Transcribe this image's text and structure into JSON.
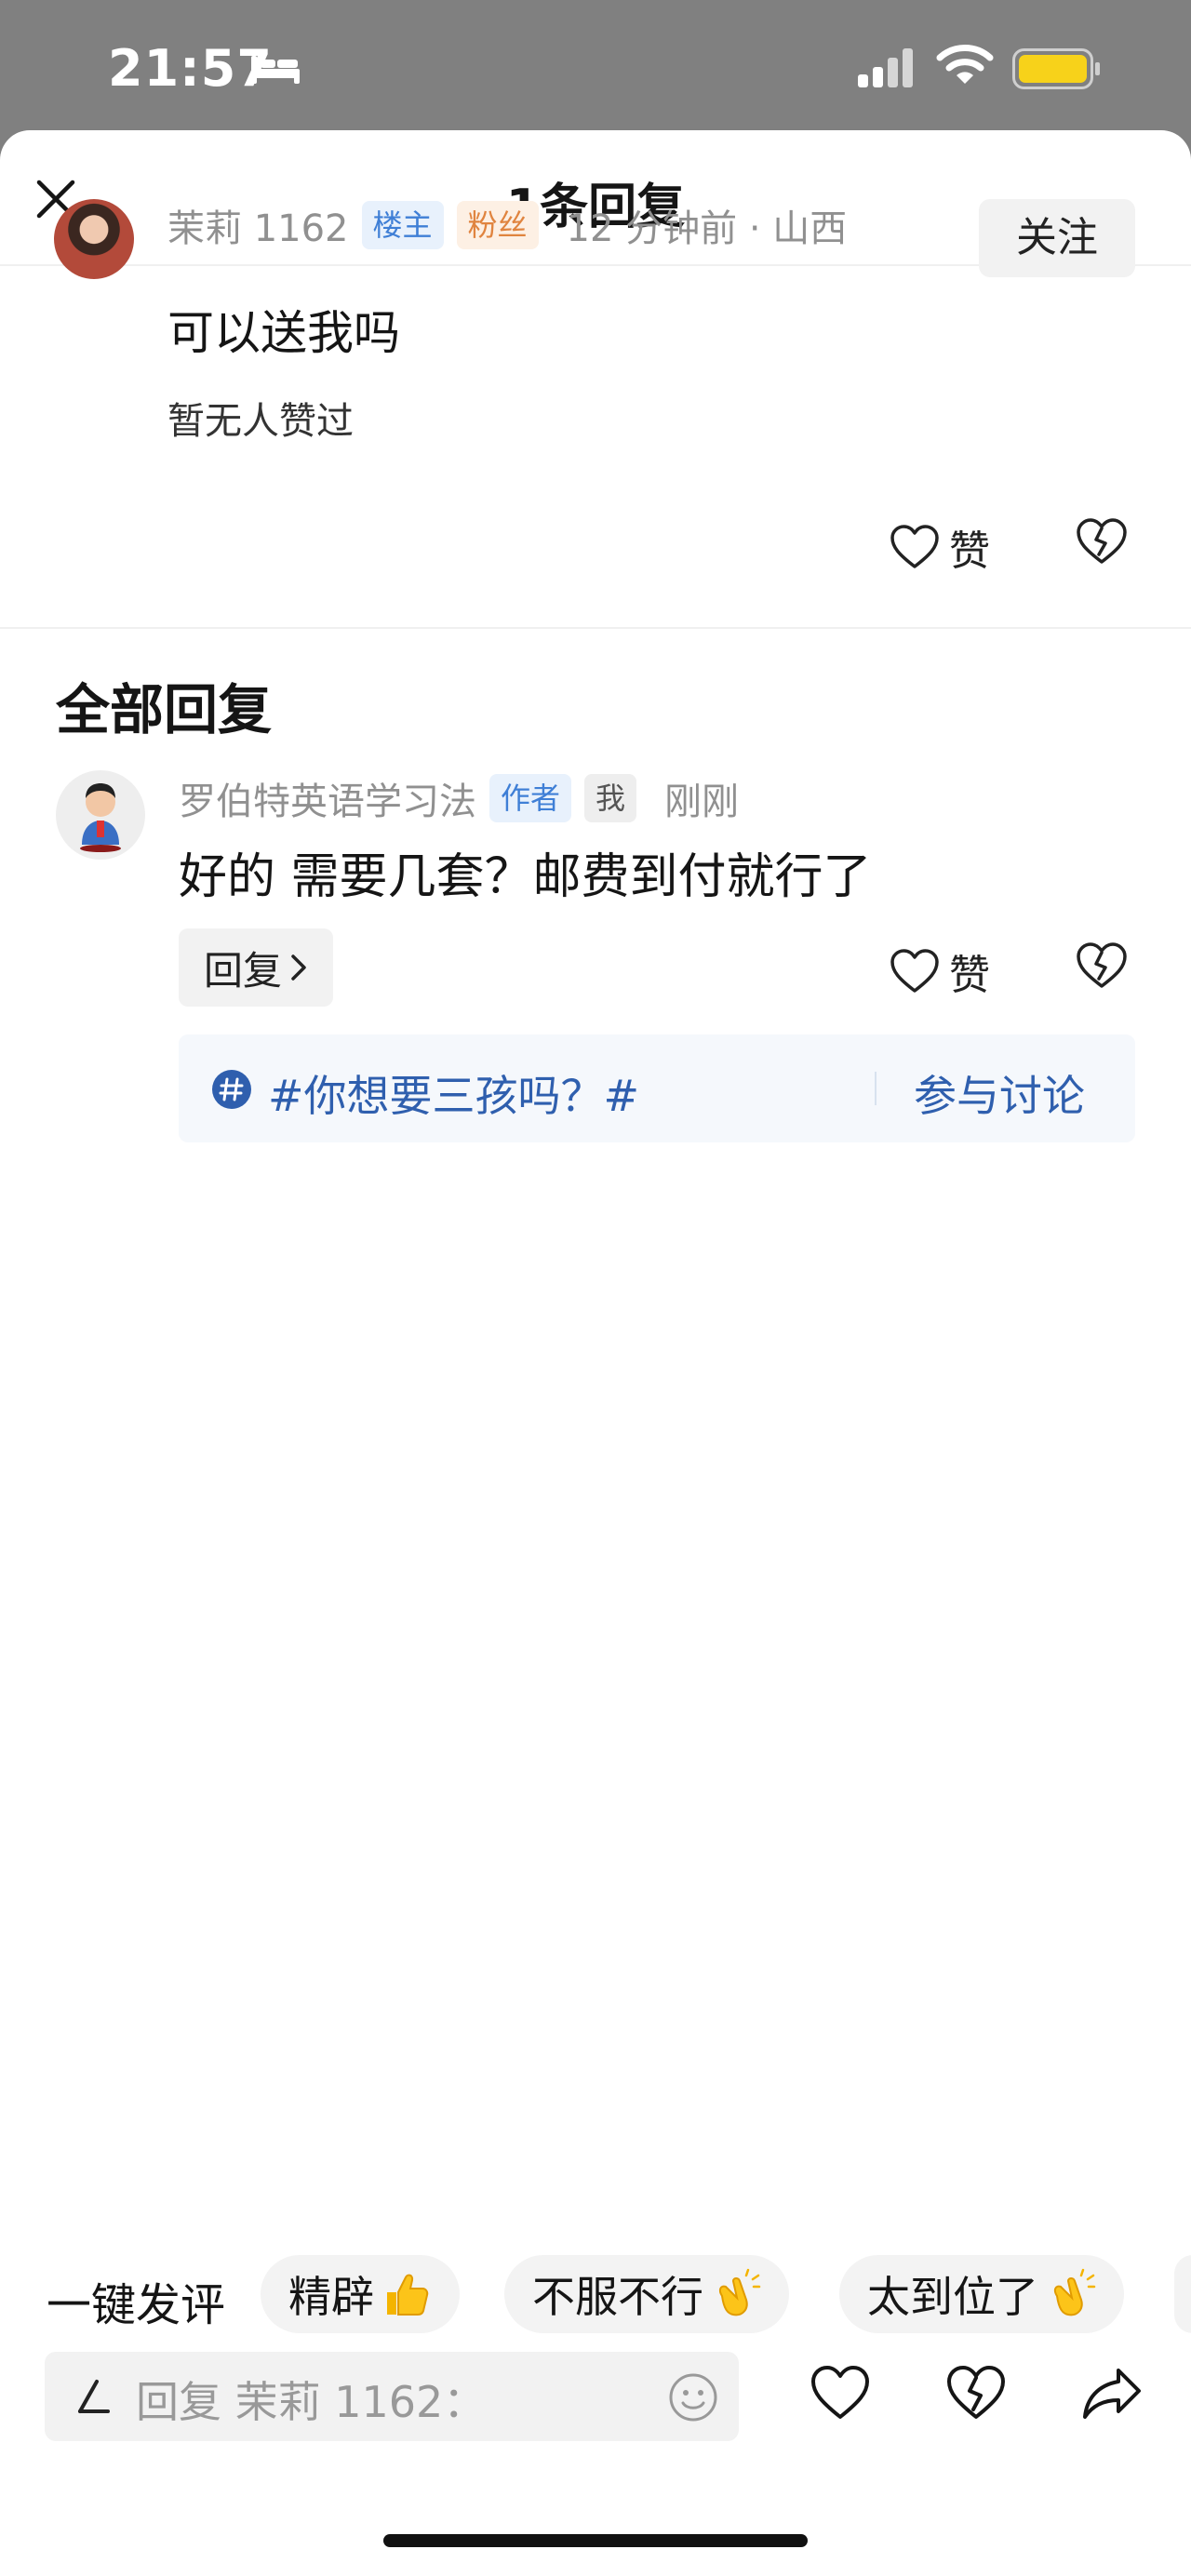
{
  "status_bar": {
    "time": "21:57"
  },
  "header": {
    "title": "1条回复"
  },
  "original_comment": {
    "username": "茉莉 1162",
    "tags": [
      "楼主",
      "粉丝"
    ],
    "time_location": "12 分钟前 · 山西",
    "follow_label": "关注",
    "text": "可以送我吗",
    "likes_status": "暂无人赞过",
    "like_label": "赞"
  },
  "replies_section": {
    "title": "全部回复"
  },
  "reply": {
    "username": "罗伯特英语学习法",
    "tags": [
      "作者",
      "我"
    ],
    "time": "刚刚",
    "text": "好的 需要几套？邮费到付就行了",
    "reply_button_label": "回复",
    "like_label": "赞"
  },
  "topic_card": {
    "topic": "#你想要三孩吗？#",
    "join_label": "参与讨论"
  },
  "quick_comments": {
    "label": "一键发评",
    "chips": [
      "精辟",
      "不服不行",
      "太到位了"
    ]
  },
  "input_bar": {
    "placeholder": "回复 茉莉 1162："
  },
  "colors": {
    "accent_blue": "#2f5fae",
    "tag_blue": "#3f7fd6",
    "tag_orange": "#e0843f",
    "battery_yellow": "#f7d21a"
  }
}
